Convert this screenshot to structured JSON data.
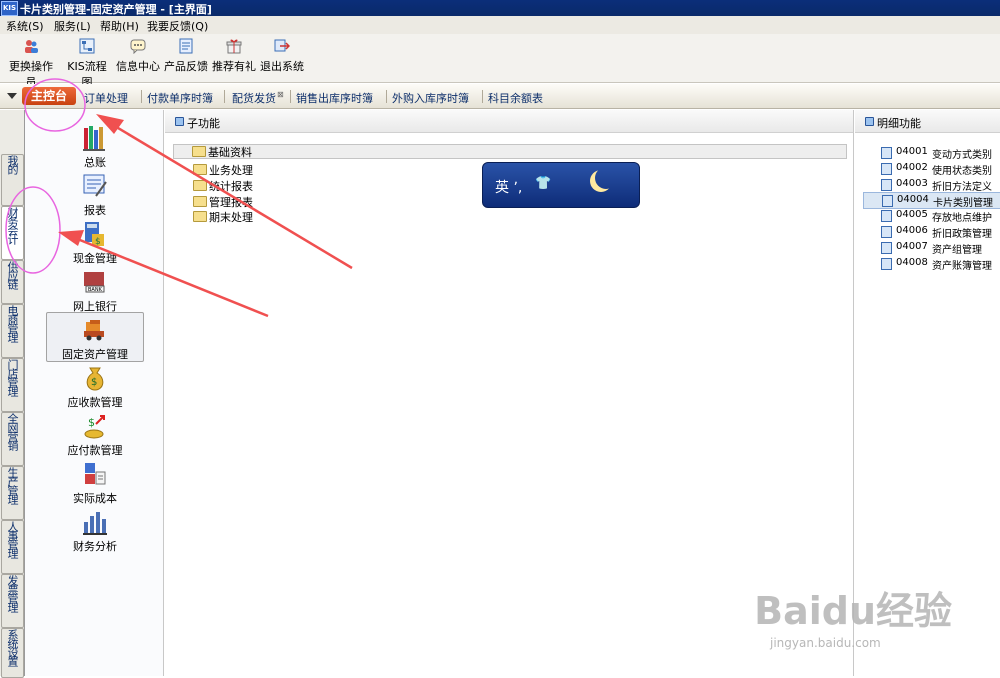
{
  "window": {
    "logo": "KIS",
    "title": "卡片类别管理-固定资产管理 - [主界面]"
  },
  "menu": [
    "系统(S)",
    "服务(L)",
    "帮助(H)",
    "我要反馈(Q)"
  ],
  "toolbar": [
    "更换操作员",
    "KIS流程图",
    "信息中心",
    "产品反馈",
    "推荐有礼",
    "退出系统"
  ],
  "tabs": {
    "main": "主控台",
    "items": [
      "订单处理",
      "付款单序时簿",
      "配货发货",
      "销售出库序时簿",
      "外购入库序时簿",
      "科目余额表"
    ]
  },
  "vertical_tabs": [
    "我的KIS",
    "财务会计",
    "供应链",
    "电商管理",
    "门店管理",
    "全网营销",
    "生产管理",
    "人事管理",
    "发票管理",
    "系统设置"
  ],
  "modules": [
    "总账",
    "报表",
    "现金管理",
    "网上银行",
    "固定资产管理",
    "应收款管理",
    "应付款管理",
    "实际成本",
    "财务分析"
  ],
  "sub_functions": {
    "header": "子功能",
    "folders": [
      "基础资料",
      "业务处理",
      "统计报表",
      "管理报表",
      "期末处理"
    ]
  },
  "details": {
    "header": "明细功能",
    "items": [
      {
        "code": "04001",
        "name": "变动方式类别"
      },
      {
        "code": "04002",
        "name": "使用状态类别"
      },
      {
        "code": "04003",
        "name": "折旧方法定义"
      },
      {
        "code": "04004",
        "name": "卡片类别管理"
      },
      {
        "code": "04005",
        "name": "存放地点维护"
      },
      {
        "code": "04006",
        "name": "折旧政策管理"
      },
      {
        "code": "04007",
        "name": "资产组管理"
      },
      {
        "code": "04008",
        "name": "资产账簿管理"
      }
    ]
  },
  "ime": {
    "text": "英 ʼ,"
  },
  "watermark": {
    "brand": "Baidu经验",
    "url": "jingyan.baidu.com"
  },
  "colors": {
    "titlebar": "#0b2e7a",
    "main_tab": "#d9531e",
    "annotation_circle": "#e865e0",
    "annotation_arrow": "#f05050"
  }
}
